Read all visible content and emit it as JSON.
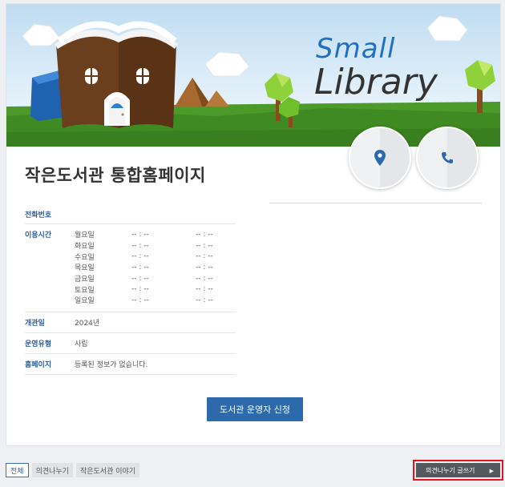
{
  "banner": {
    "title_small": "Small",
    "title_big": "Library"
  },
  "page_title": "작은도서관 통합홈페이지",
  "info": {
    "phone_label": "전화번호",
    "phone_value": "",
    "hours_label": "이용시간",
    "hours": [
      {
        "day": "월요일",
        "open": "-- : --",
        "close": "-- : --"
      },
      {
        "day": "화요일",
        "open": "-- : --",
        "close": "-- : --"
      },
      {
        "day": "수요일",
        "open": "-- : --",
        "close": "-- : --"
      },
      {
        "day": "목요일",
        "open": "-- : --",
        "close": "-- : --"
      },
      {
        "day": "금요일",
        "open": "-- : --",
        "close": "-- : --"
      },
      {
        "day": "토요일",
        "open": "-- : --",
        "close": "-- : --"
      },
      {
        "day": "일요일",
        "open": "-- : --",
        "close": "-- : --"
      }
    ],
    "opened_label": "개관일",
    "opened_value": "2024년",
    "type_label": "운영유형",
    "type_value": "사립",
    "homepage_label": "홈페이지",
    "homepage_value": "등록된 정보가 없습니다."
  },
  "apply_button": "도서관 운영자 신청",
  "tabs": [
    {
      "label": "전체",
      "active": true
    },
    {
      "label": "의견나누기",
      "active": false
    },
    {
      "label": "작은도서관 이야기",
      "active": false
    }
  ],
  "write_button": "의견나누기 글쓰기",
  "write_arrow": "▶",
  "colors": {
    "accent": "#2d6aab",
    "label": "#2f5d9b",
    "highlight": "#e4141f"
  },
  "icons": {
    "map": "map-pin-icon",
    "phone": "phone-icon"
  }
}
